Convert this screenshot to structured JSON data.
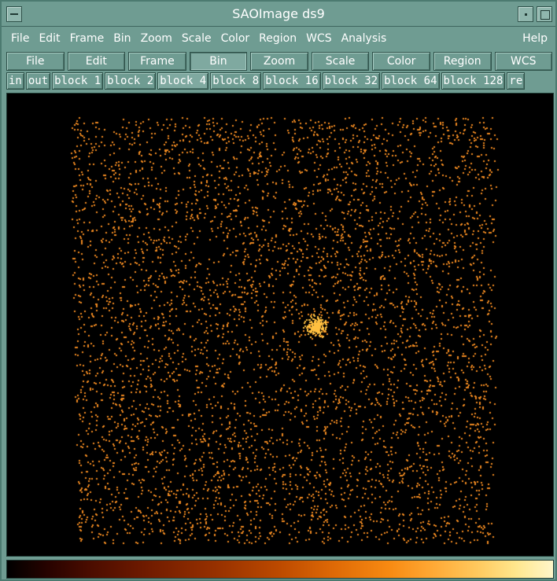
{
  "window": {
    "title": "SAOImage ds9"
  },
  "menubar": {
    "items": [
      "File",
      "Edit",
      "Frame",
      "Bin",
      "Zoom",
      "Scale",
      "Color",
      "Region",
      "WCS",
      "Analysis"
    ],
    "help": "Help"
  },
  "buttonbar": {
    "items": [
      "File",
      "Edit",
      "Frame",
      "Bin",
      "Zoom",
      "Scale",
      "Color",
      "Region",
      "WCS"
    ],
    "active": "Bin"
  },
  "subbar": {
    "items": [
      "in",
      "out",
      "block 1",
      "block 2",
      "block 4",
      "block 8",
      "block 16",
      "block 32",
      "block 64",
      "block 128",
      "re"
    ],
    "active": "block 4"
  },
  "image": {
    "description_icon": "xray-event-image",
    "colormap": "sls",
    "colors": {
      "background": "#000000",
      "event": "#f08a20",
      "bright": "#ffc040"
    }
  },
  "colors": {
    "chrome": "#6f9c92",
    "chrome_dark": "#2f524a",
    "text": "#ffffff"
  }
}
